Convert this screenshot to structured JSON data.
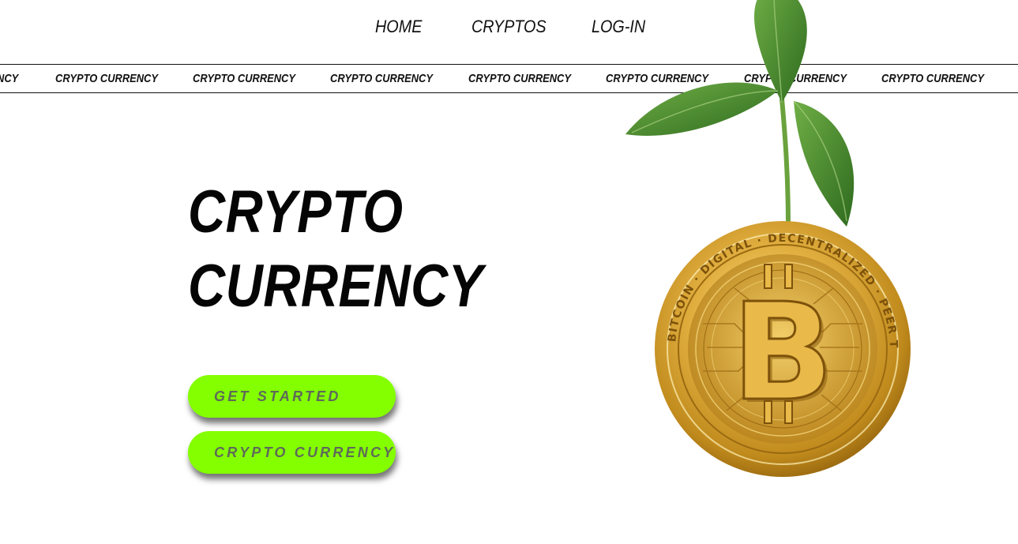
{
  "nav": {
    "items": [
      {
        "label": "HOME"
      },
      {
        "label": "CRYPTOS"
      },
      {
        "label": "LOG-IN"
      }
    ]
  },
  "ticker": {
    "text_partial": "NCY",
    "text": "CRYPTO CURRENCY"
  },
  "hero": {
    "title_line1": "CRYPTO",
    "title_line2": "CURRENCY",
    "image": {
      "icon": "bitcoin-sprout-image",
      "coin_symbol": "B",
      "coin_ring_text": "BITCOIN · DIGITAL · DECENTRALIZED · PEER TO PEER"
    }
  },
  "buttons": {
    "get_started": "GET STARTED",
    "crypto_currency": "CRYPTO CURRENCY"
  },
  "colors": {
    "accent": "#84ff00",
    "text": "#111111",
    "button_text": "#5e6a5a",
    "coin_gold": "#d9a52a",
    "leaf_green": "#4f8f32"
  }
}
